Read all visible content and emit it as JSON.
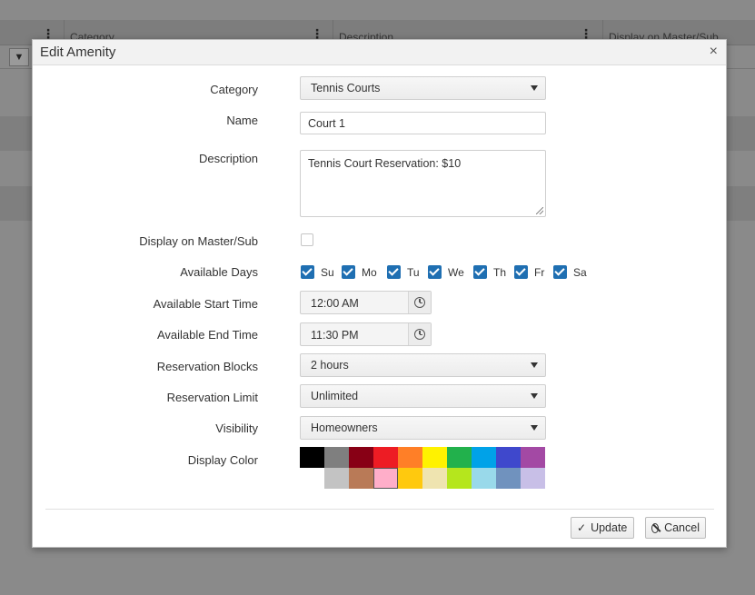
{
  "background": {
    "columns": [
      "Category",
      "Description",
      "Display on Master/Sub"
    ]
  },
  "modal": {
    "title": "Edit Amenity",
    "close_label": "×",
    "fields": {
      "category": {
        "label": "Category",
        "value": "Tennis Courts"
      },
      "name": {
        "label": "Name",
        "value": "Court 1"
      },
      "description": {
        "label": "Description",
        "value": "Tennis Court Reservation: $10"
      },
      "display_master_sub": {
        "label": "Display on Master/Sub",
        "checked": false
      },
      "available_days": {
        "label": "Available Days",
        "days": [
          {
            "label": "Su",
            "checked": true
          },
          {
            "label": "Mo",
            "checked": true
          },
          {
            "label": "Tu",
            "checked": true
          },
          {
            "label": "We",
            "checked": true
          },
          {
            "label": "Th",
            "checked": true
          },
          {
            "label": "Fr",
            "checked": true
          },
          {
            "label": "Sa",
            "checked": true
          }
        ]
      },
      "start_time": {
        "label": "Available Start Time",
        "value": "12:00 AM"
      },
      "end_time": {
        "label": "Available End Time",
        "value": "11:30 PM"
      },
      "reservation_blocks": {
        "label": "Reservation Blocks",
        "value": "2 hours"
      },
      "reservation_limit": {
        "label": "Reservation Limit",
        "value": "Unlimited"
      },
      "visibility": {
        "label": "Visibility",
        "value": "Homeowners"
      },
      "display_color": {
        "label": "Display Color",
        "row1": [
          "#000000",
          "#7f7f7f",
          "#880015",
          "#ed1c24",
          "#ff7f27",
          "#fff200",
          "#22b14c",
          "#00a2e8",
          "#3f48cc",
          "#a349a4"
        ],
        "row2": [
          "#ffffff",
          "#c3c3c3",
          "#b97a57",
          "#ffaec9",
          "#ffc90e",
          "#efe4b0",
          "#b5e61d",
          "#99d9ea",
          "#7092be",
          "#c8bfe7"
        ],
        "selected": "#ffaec9"
      }
    },
    "buttons": {
      "update": "Update",
      "cancel": "Cancel"
    }
  }
}
